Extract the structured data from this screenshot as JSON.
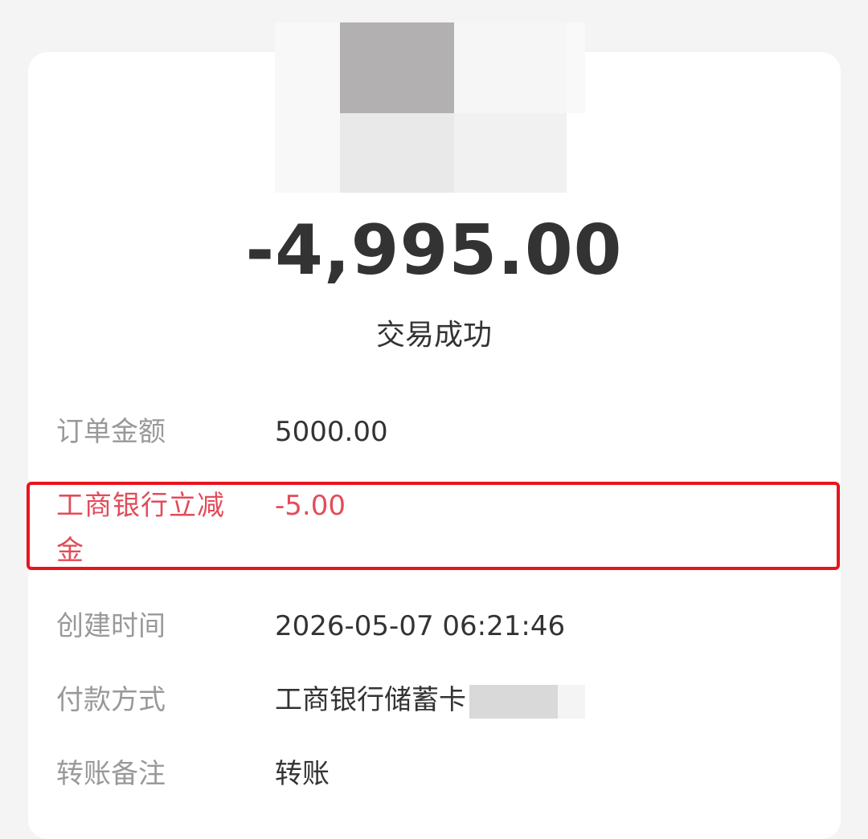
{
  "transaction": {
    "amount": "-4,995.00",
    "status": "交易成功"
  },
  "details": {
    "order_amount": {
      "label": "订单金额",
      "value": "5000.00"
    },
    "discount": {
      "label": "工商银行立减金",
      "value": "-5.00"
    },
    "created_time": {
      "label": "创建时间",
      "value": "2026-05-07 06:21:46"
    },
    "payment_method": {
      "label": "付款方式",
      "value": "工商银行储蓄卡"
    },
    "remark": {
      "label": "转账备注",
      "value": "转账"
    }
  },
  "colors": {
    "discount_text": "#e34c59",
    "highlight_border": "#e8141d",
    "primary_text": "#333333",
    "secondary_text": "#999999"
  },
  "icons": {
    "avatar": "blurred-avatar-image"
  }
}
